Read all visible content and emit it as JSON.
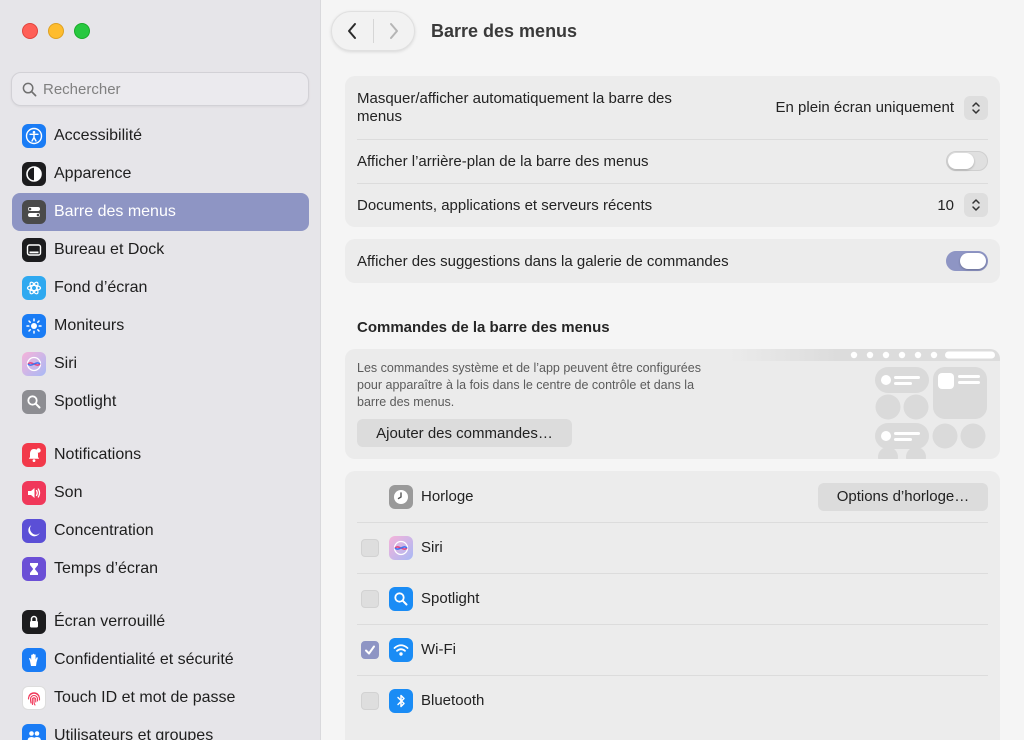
{
  "window": {
    "title": "Barre des menus"
  },
  "search": {
    "placeholder": "Rechercher"
  },
  "sidebar": {
    "items": [
      {
        "label": "Accessibilité",
        "icon": "accessibility-icon",
        "color": "#1a7cf5"
      },
      {
        "label": "Apparence",
        "icon": "appearance-icon",
        "color": "#1c1c1e"
      },
      {
        "label": "Barre des menus",
        "icon": "menubar-icon",
        "color": "#4a4a4a",
        "selected": true
      },
      {
        "label": "Bureau et Dock",
        "icon": "dock-icon",
        "color": "#1c1c1e"
      },
      {
        "label": "Fond d’écran",
        "icon": "wallpaper-icon",
        "color": "#2fa9f0"
      },
      {
        "label": "Moniteurs",
        "icon": "displays-icon",
        "color": "#1a7cf5"
      },
      {
        "label": "Siri",
        "icon": "siri-icon",
        "color": "#d96fd0"
      },
      {
        "label": "Spotlight",
        "icon": "spotlight-icon",
        "color": "#8d8d92"
      },
      {
        "label": "Notifications",
        "icon": "notifications-icon",
        "color": "#f2394a"
      },
      {
        "label": "Son",
        "icon": "sound-icon",
        "color": "#f0385a"
      },
      {
        "label": "Concentration",
        "icon": "focus-icon",
        "color": "#5b4fd6"
      },
      {
        "label": "Temps d’écran",
        "icon": "screentime-icon",
        "color": "#6b4fd6"
      },
      {
        "label": "Écran verrouillé",
        "icon": "lock-icon",
        "color": "#1c1c1e"
      },
      {
        "label": "Confidentialité et sécurité",
        "icon": "privacy-hand-icon",
        "color": "#1a7cf5"
      },
      {
        "label": "Touch ID et mot de passe",
        "icon": "fingerprint-icon",
        "color": "#ffffff"
      },
      {
        "label": "Utilisateurs et groupes",
        "icon": "users-icon",
        "color": "#1a7cf5"
      }
    ]
  },
  "settings": {
    "autohide_label": "Masquer/afficher automatiquement la barre des menus",
    "autohide_value": "En plein écran uniquement",
    "background_label": "Afficher l’arrière-plan de la barre des menus",
    "background_on": false,
    "recent_label": "Documents, applications et serveurs récents",
    "recent_value": "10",
    "suggestions_label": "Afficher des suggestions dans la galerie de commandes",
    "suggestions_on": true
  },
  "controls_section": {
    "title": "Commandes de la barre des menus",
    "description": "Les commandes système et de l’app peuvent être configurées pour apparaître à la fois dans le centre de contrôle et dans la barre des menus.",
    "add_button": "Ajouter des commandes…"
  },
  "controls_list": {
    "clock_label": "Horloge",
    "clock_button": "Options d’horloge…",
    "rows": [
      {
        "label": "Siri",
        "checked": false,
        "icon": "siri-icon"
      },
      {
        "label": "Spotlight",
        "checked": false,
        "icon": "spotlight-icon"
      },
      {
        "label": "Wi-Fi",
        "checked": true,
        "icon": "wifi-icon"
      },
      {
        "label": "Bluetooth",
        "checked": false,
        "icon": "bluetooth-icon"
      }
    ]
  },
  "colors": {
    "accent": "#8e95c4",
    "sidebar_bg": "#e6e5e9"
  }
}
